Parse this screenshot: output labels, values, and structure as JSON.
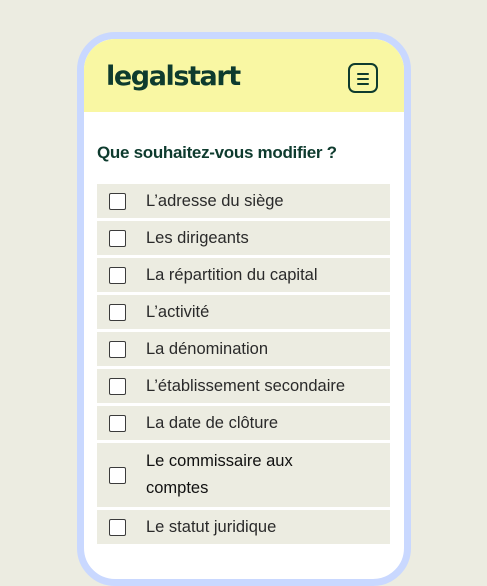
{
  "header": {
    "logo": "legalstart",
    "menu_icon": "hamburger-menu-icon"
  },
  "form": {
    "question": "Que souhaitez-vous modifier ?",
    "options": [
      {
        "label": "L’adresse du siège",
        "checked": false
      },
      {
        "label": "Les dirigeants",
        "checked": false
      },
      {
        "label": "La répartition du capital",
        "checked": false
      },
      {
        "label": "L’activité",
        "checked": false
      },
      {
        "label": "La dénomination",
        "checked": false
      },
      {
        "label": "L’établissement secondaire",
        "checked": false
      },
      {
        "label": "La date de clôture",
        "checked": false
      },
      {
        "label": "Le commissaire aux comptes",
        "checked": false
      },
      {
        "label": "Le statut juridique",
        "checked": false
      }
    ]
  },
  "colors": {
    "background": "#ecece1",
    "phone_frame": "#c9d8ff",
    "header_background": "#f9f7a3",
    "brand_text": "#0e3b2e",
    "option_background": "#ecece1"
  }
}
